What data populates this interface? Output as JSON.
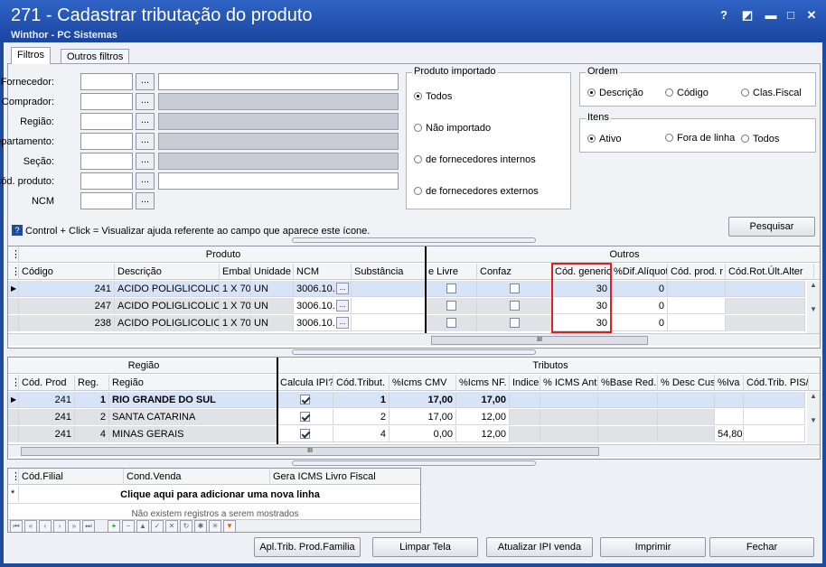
{
  "window": {
    "title": "271 - Cadastrar tributação do produto",
    "subtitle": "Winthor - PC Sistemas",
    "controls": [
      "?",
      "◩",
      "▬",
      "□",
      "✕"
    ]
  },
  "tabs": [
    "Filtros",
    "Outros filtros"
  ],
  "filters": {
    "labels": [
      "Fornecedor:",
      "Comprador:",
      "Região:",
      "Departamento:",
      "Seção:",
      "Cód. produto:",
      "NCM"
    ],
    "dots": "..."
  },
  "produto_importado": {
    "title": "Produto importado",
    "options": [
      "Todos",
      "Não importado",
      "de fornecedores internos",
      "de fornecedores externos"
    ],
    "selected": 0
  },
  "ordem": {
    "title": "Ordem",
    "options": [
      "Descrição",
      "Código",
      "Clas.Fiscal"
    ],
    "selected": 0
  },
  "itens": {
    "title": "Itens",
    "options": [
      "Ativo",
      "Fora de linha",
      "Todos"
    ],
    "selected": 0
  },
  "help_text": "Control + Click = Visualizar ajuda referente ao campo que aparece este ícone.",
  "pesquisar_label": "Pesquisar",
  "grid1": {
    "bands": [
      "Produto",
      "Outros"
    ],
    "headers": [
      "Código",
      "Descrição",
      "Embal.",
      "Unidade",
      "NCM",
      "Substância",
      "e Livre",
      "Confaz",
      "Cód. generico",
      "%Dif.Alíquot",
      "Cód. prod. r",
      "Cód.Rot.Últ.Alter"
    ],
    "rows": [
      {
        "codigo": "241",
        "descricao": "ACIDO POLIGLICOLICO",
        "embal": "1 X 70",
        "unidade": "UN",
        "ncm": "3006.10.",
        "cod_generico": "30",
        "dif_aliq": "0"
      },
      {
        "codigo": "247",
        "descricao": "ACIDO POLIGLICOLICO",
        "embal": "1 X 70",
        "unidade": "UN",
        "ncm": "3006.10.",
        "cod_generico": "30",
        "dif_aliq": "0"
      },
      {
        "codigo": "238",
        "descricao": "ACIDO POLIGLICOLICO",
        "embal": "1 X 70",
        "unidade": "UN",
        "ncm": "3006.10.",
        "cod_generico": "30",
        "dif_aliq": "0"
      }
    ]
  },
  "grid2": {
    "bands": [
      "Região",
      "Tributos"
    ],
    "headers": [
      "Cód. Prod",
      "Reg.",
      "Região",
      "Calcula IPI?",
      "Cód.Tribut.",
      "%Icms CMV",
      "%Icms NF.",
      "Indice",
      "% ICMS Ant",
      "%Base Red.",
      "% Desc Cus",
      "%Iva",
      "Cód.Trib. PIS/"
    ],
    "rows": [
      {
        "cod_prod": "241",
        "reg": "1",
        "regiao": "RIO GRANDE DO SUL",
        "cod_trib": "1",
        "icms_cmv": "17,00",
        "icms_nf": "17,00",
        "iva": ""
      },
      {
        "cod_prod": "241",
        "reg": "2",
        "regiao": "SANTA CATARINA",
        "cod_trib": "2",
        "icms_cmv": "17,00",
        "icms_nf": "12,00",
        "iva": ""
      },
      {
        "cod_prod": "241",
        "reg": "4",
        "regiao": "MINAS GERAIS",
        "cod_trib": "4",
        "icms_cmv": "0,00",
        "icms_nf": "12,00",
        "iva": "54,80"
      }
    ]
  },
  "grid3": {
    "headers": [
      "Cód.Filial",
      "Cond.Venda",
      "Gera ICMS Livro Fiscal"
    ],
    "add_row": "Clique aqui para adicionar uma nova linha",
    "empty": "Não existem registros a serem mostrados"
  },
  "footer_buttons": [
    "Apl.Trib. Prod.Familia",
    "Limpar Tela",
    "Atualizar IPI venda",
    "Imprimir",
    "Fechar"
  ],
  "scroll_grip": "III",
  "colors": {
    "titlebar": "#1d4ba0",
    "highlight": "#e02020",
    "selected_row": "#d7e4f7"
  }
}
